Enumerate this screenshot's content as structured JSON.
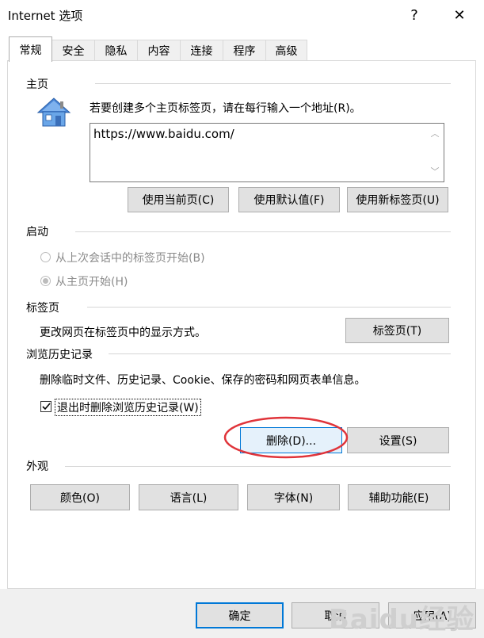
{
  "window": {
    "title": "Internet 选项",
    "help_label": "?",
    "close_label": "✕"
  },
  "tabs": [
    {
      "label": "常规"
    },
    {
      "label": "安全"
    },
    {
      "label": "隐私"
    },
    {
      "label": "内容"
    },
    {
      "label": "连接"
    },
    {
      "label": "程序"
    },
    {
      "label": "高级"
    }
  ],
  "home": {
    "section_title": "主页",
    "instruction": "若要创建多个主页标签页，请在每行输入一个地址(R)。",
    "url": "https://www.baidu.com/",
    "buttons": {
      "use_current": "使用当前页(C)",
      "use_default": "使用默认值(F)",
      "use_new_tab": "使用新标签页(U)"
    }
  },
  "startup": {
    "section_title": "启动",
    "options": [
      {
        "label": "从上次会话中的标签页开始(B)",
        "selected": false
      },
      {
        "label": "从主页开始(H)",
        "selected": true
      }
    ]
  },
  "tabs_section": {
    "section_title": "标签页",
    "description": "更改网页在标签页中的显示方式。",
    "button": "标签页(T)"
  },
  "history": {
    "section_title": "浏览历史记录",
    "description": "删除临时文件、历史记录、Cookie、保存的密码和网页表单信息。",
    "checkbox_label": "退出时删除浏览历史记录(W)",
    "checkbox_checked": true,
    "delete_button": "删除(D)...",
    "settings_button": "设置(S)"
  },
  "appearance": {
    "section_title": "外观",
    "buttons": {
      "colors": "颜色(O)",
      "languages": "语言(L)",
      "fonts": "字体(N)",
      "accessibility": "辅助功能(E)"
    }
  },
  "footer": {
    "ok": "确定",
    "cancel": "取消",
    "apply": "应用(A)"
  },
  "watermark": "Baidu经验",
  "colors": {
    "focus_border": "#0078d7",
    "annotation_red": "#e0343a"
  }
}
